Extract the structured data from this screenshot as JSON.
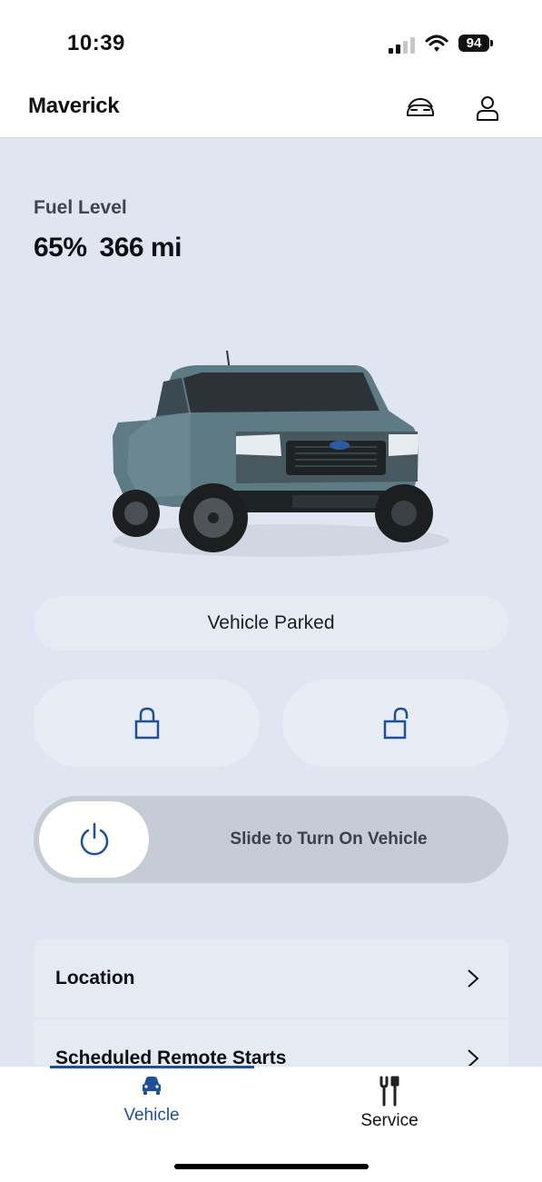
{
  "status_bar": {
    "time": "10:39",
    "battery": "94"
  },
  "header": {
    "title": "Maverick"
  },
  "fuel": {
    "label": "Fuel Level",
    "percent": "65%",
    "range": "366 mi",
    "level": 0.65
  },
  "vehicle_status": "Vehicle Parked",
  "controls": {
    "slider_text": "Slide to Turn On Vehicle"
  },
  "list": {
    "items": [
      {
        "label": "Location"
      },
      {
        "label": "Scheduled Remote Starts"
      }
    ]
  },
  "tabs": [
    {
      "label": "Vehicle",
      "active": true
    },
    {
      "label": "Service",
      "active": false
    }
  ],
  "colors": {
    "accent": "#1c4f9c",
    "background": "#dfe6f1",
    "card": "#e6ebf3",
    "slider_track": "#c6ccd6"
  },
  "icons": [
    "signal-icon",
    "wifi-icon",
    "battery-icon",
    "garage-icon",
    "account-icon",
    "lock-icon",
    "unlock-icon",
    "power-icon",
    "chevron-right-icon",
    "vehicle-icon",
    "wrench-icon"
  ]
}
